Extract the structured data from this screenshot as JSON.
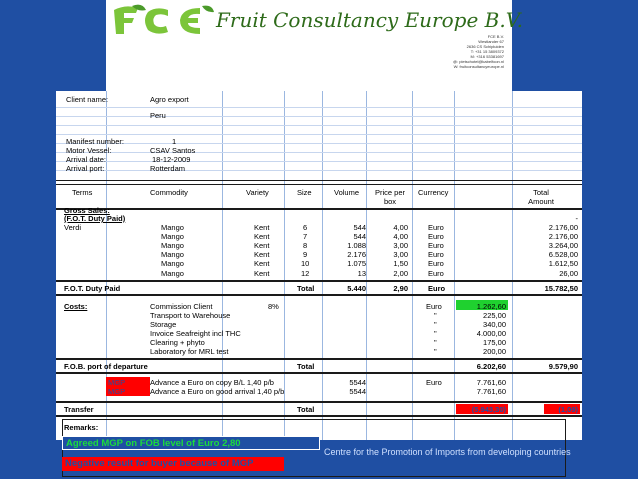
{
  "header": {
    "company": "Fruit Consultancy Europe B.V.",
    "logo_text": "FCE",
    "address_lines": [
      "FCE B.V.",
      "Westlander 67",
      "2636 CS Schipluiden",
      "T: +31 15 3809372",
      "M: +316 53381697",
      "@: pietschotel@kabelfoon.nl",
      "W: fruitconsultancyeurope.nl"
    ]
  },
  "client": {
    "name_label": "Client name:",
    "name": "Agro export",
    "country": "Peru",
    "manifest_label": "Manifest number:",
    "manifest": "1",
    "vessel_label": "Motor Vessel:",
    "vessel": "CSAV Santos",
    "arrival_date_label": "Arrival date:",
    "arrival_date": "18-12-2009",
    "arrival_port_label": "Arrival port:",
    "arrival_port": "Rotterdam"
  },
  "columns": {
    "terms": "Terms",
    "commodity": "Commodity",
    "variety": "Variety",
    "size": "Size",
    "volume": "Volume",
    "price_l1": "Price per",
    "price_l2": "box",
    "currency": "Currency",
    "total_l1": "Total",
    "total_l2": "Amount"
  },
  "gross": {
    "title": "Gross Sales:",
    "subtitle": "(F.O.T. Duty Paid)",
    "dash": "-",
    "rows": [
      {
        "terms": "Verdi",
        "commodity": "Mango",
        "variety": "Kent",
        "size": "6",
        "volume": "544",
        "price": "4,00",
        "currency": "Euro",
        "amount": "2.176,00"
      },
      {
        "terms": "",
        "commodity": "Mango",
        "variety": "Kent",
        "size": "7",
        "volume": "544",
        "price": "4,00",
        "currency": "Euro",
        "amount": "2.176,00"
      },
      {
        "terms": "",
        "commodity": "Mango",
        "variety": "Kent",
        "size": "8",
        "volume": "1.088",
        "price": "3,00",
        "currency": "Euro",
        "amount": "3.264,00"
      },
      {
        "terms": "",
        "commodity": "Mango",
        "variety": "Kent",
        "size": "9",
        "volume": "2.176",
        "price": "3,00",
        "currency": "Euro",
        "amount": "6.528,00"
      },
      {
        "terms": "",
        "commodity": "Mango",
        "variety": "Kent",
        "size": "10",
        "volume": "1.075",
        "price": "1,50",
        "currency": "Euro",
        "amount": "1.612,50"
      },
      {
        "terms": "",
        "commodity": "Mango",
        "variety": "Kent",
        "size": "12",
        "volume": "13",
        "price": "2,00",
        "currency": "Euro",
        "amount": "26,00"
      }
    ]
  },
  "fot": {
    "label": "F.O.T. Duty Paid",
    "total_label": "Total",
    "volume": "5.440",
    "price": "2,90",
    "currency": "Euro",
    "amount": "15.782,50"
  },
  "costs": {
    "title": "Costs:",
    "commission_pct": "8%",
    "rows": [
      {
        "label": "Commission Client",
        "currency": "Euro",
        "amount": "1.262,60"
      },
      {
        "label": "Transport to Warehouse",
        "currency": "\"",
        "amount": "225,00"
      },
      {
        "label": "Storage",
        "currency": "\"",
        "amount": "340,00"
      },
      {
        "label": "Invoice Seafreight incl THC",
        "currency": "\"",
        "amount": "4.000,00"
      },
      {
        "label": "Clearing + phyto",
        "currency": "\"",
        "amount": "175,00"
      },
      {
        "label": "Laboratory for MRL test",
        "currency": "\"",
        "amount": "200,00"
      }
    ]
  },
  "fob": {
    "label": "F.O.B. port of departure",
    "total_label": "Total",
    "currency": "Euro",
    "costs_total": "6.202,60",
    "amount": "9.579,90"
  },
  "advances": {
    "rows": [
      {
        "tag": "MGP",
        "label": "Advance a Euro on copy B/L 1,40 p/b",
        "volume": "5544",
        "currency": "Euro",
        "amount": "7.761,60"
      },
      {
        "tag": "MGP",
        "label": "Advance a Euro on good arrival 1,40 p/b",
        "volume": "5544",
        "currency": "",
        "amount": "7.761,60"
      }
    ]
  },
  "transfer": {
    "label": "Transfer",
    "total_label": "Total",
    "amount1": "(5.943,30)",
    "amount2": "(1,09)"
  },
  "remarks": {
    "label": "Remarks:"
  },
  "footer": {
    "agreed": "Agreed MGP on FOB level of Euro 2,80",
    "negative": "Negative result for buyer because of MGP",
    "cbi": "Centre for the Promotion of Imports from developing countries"
  },
  "colors": {
    "blue": "#1f4fa3",
    "green_highlight": "#1fd12f",
    "red_highlight": "#ff0000",
    "brand_green": "#2e6b1a"
  }
}
